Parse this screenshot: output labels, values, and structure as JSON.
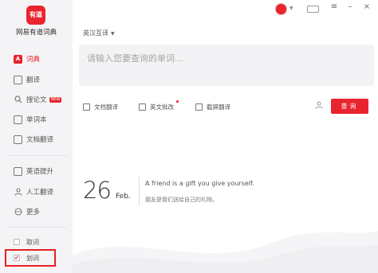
{
  "app": {
    "logo_text": "有道",
    "name": "网易有道词典"
  },
  "sidebar": {
    "items": [
      {
        "label": "词典",
        "icon": "dictionary-icon",
        "active": true
      },
      {
        "label": "翻译",
        "icon": "translate-icon"
      },
      {
        "label": "搜论文",
        "icon": "paper-search-icon",
        "badge": "NEW"
      },
      {
        "label": "单词本",
        "icon": "wordbook-icon"
      },
      {
        "label": "文档翻译",
        "icon": "document-translate-icon"
      },
      {
        "label": "英语提升",
        "icon": "english-improve-icon"
      },
      {
        "label": "人工翻译",
        "icon": "human-translate-icon"
      },
      {
        "label": "更多",
        "icon": "more-icon"
      }
    ],
    "bottom": [
      {
        "label": "取词",
        "checked": false
      },
      {
        "label": "划词",
        "checked": true
      }
    ]
  },
  "main": {
    "language": "英汉互译",
    "search_placeholder": "请输入您要查询的单词...",
    "tools": [
      {
        "label": "文档翻译",
        "icon": "document-icon"
      },
      {
        "label": "英文批改",
        "icon": "correction-icon",
        "dot": true
      },
      {
        "label": "截屏翻译",
        "icon": "screenshot-icon"
      }
    ],
    "query_button": "查询",
    "daily": {
      "day": "26",
      "month": "Feb.",
      "quote_en": "A friend is a gift you give yourself.",
      "quote_zh": "朋友是我们送给自己的礼物。"
    }
  },
  "colors": {
    "accent": "#e8252f",
    "sidebar_bg": "#f4f4f6",
    "search_bg": "#f3f3f5"
  }
}
